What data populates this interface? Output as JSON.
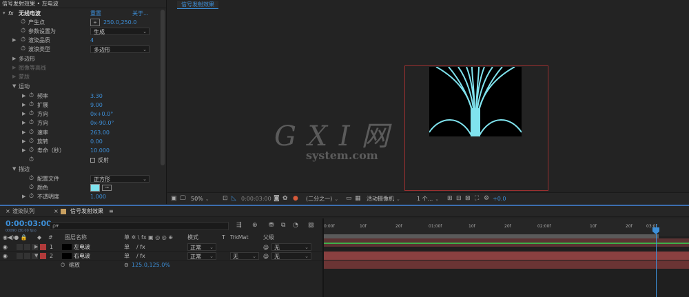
{
  "effect_controls": {
    "title": "信号发射效果 • 左电波",
    "effect_name": "无线电波",
    "reset": "重置",
    "about": "关于...",
    "rows": [
      {
        "label": "产生点",
        "value": "250.0,250.0"
      },
      {
        "label": "参数设置为",
        "value": "生成"
      },
      {
        "label": "渲染品质",
        "value": "4"
      },
      {
        "label": "波浪类型",
        "value": "多边形"
      },
      {
        "label": "多边形"
      },
      {
        "label": "图像等高线"
      },
      {
        "label": "蒙版"
      },
      {
        "label": "运动"
      },
      {
        "label": "频率",
        "value": "3.30"
      },
      {
        "label": "扩展",
        "value": "9.00"
      },
      {
        "label": "方向",
        "value": "0x+0.0°"
      },
      {
        "label": "方向",
        "value": "0x-90.0°"
      },
      {
        "label": "速率",
        "value": "263.00"
      },
      {
        "label": "旋转",
        "value": "0.00"
      },
      {
        "label": "寿命（秒）",
        "value": "10.000"
      },
      {
        "label": "",
        "value": "反射"
      },
      {
        "label": "描边"
      },
      {
        "label": "配置文件",
        "value": "正方形"
      },
      {
        "label": "颜色"
      },
      {
        "label": "不透明度",
        "value": "1.000"
      }
    ]
  },
  "viewer": {
    "tab": "信号发射效果",
    "watermark_main": "G X I 网",
    "watermark_sub": "system.com",
    "zoom": "50%",
    "timecode": "0:00:03:00",
    "resolution": "(二分之一)",
    "camera": "活动摄像机",
    "views": "1 个...",
    "exposure": "+0.0"
  },
  "timeline": {
    "tab_render": "渲染队列",
    "tab_comp": "信号发射效果",
    "timecode": "0:00:03:00",
    "fps": "00090 (30.00 fps)",
    "search_placeholder": "ρ▾",
    "headers": {
      "num": "#",
      "name": "图层名称",
      "switches": "单 ✲ \\ fx ▣ ◎ ◎ ⊕",
      "mode": "模式",
      "t": "T",
      "trkmat": "TrkMat",
      "parent": "父级"
    },
    "layers": [
      {
        "num": "1",
        "name": "左电波",
        "mode": "正常",
        "trkmat": "",
        "parent": "无"
      },
      {
        "num": "2",
        "name": "右电波",
        "mode": "正常",
        "trkmat": "无",
        "parent": "无"
      }
    ],
    "scale_label": "缩放",
    "scale_value": "125.0,125.0%",
    "ruler": [
      "0:00f",
      "10f",
      "20f",
      "01:00f",
      "10f",
      "20f",
      "02:00f",
      "10f",
      "20f",
      "03:0f"
    ]
  },
  "colors": {
    "accent": "#3d8fd8",
    "layer_red": "#b03a3a",
    "wave": "#7fe3ee",
    "comp_border": "#9b3030",
    "track_green": "#3fb04a"
  }
}
